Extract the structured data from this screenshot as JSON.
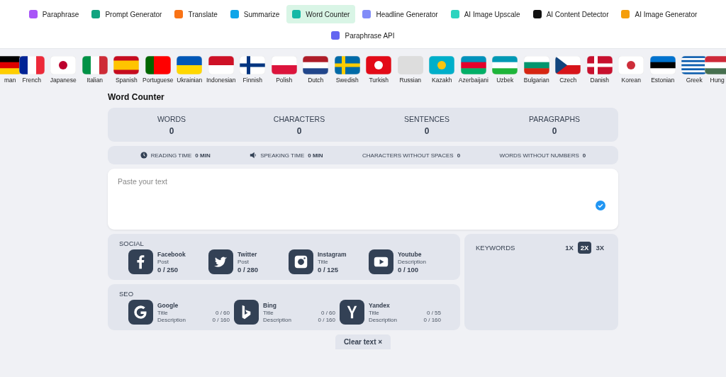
{
  "nav": [
    {
      "label": "Paraphrase",
      "color": "#a855f7",
      "selected": false
    },
    {
      "label": "Prompt Generator",
      "color": "#10a37f",
      "selected": false
    },
    {
      "label": "Translate",
      "color": "#f97316",
      "selected": false
    },
    {
      "label": "Summarize",
      "color": "#0ea5e9",
      "selected": false
    },
    {
      "label": "Word Counter",
      "color": "#14b8a6",
      "selected": true
    },
    {
      "label": "Headline Generator",
      "color": "#818cf8",
      "selected": false
    },
    {
      "label": "AI Image Upscale",
      "color": "#2dd4bf",
      "selected": false
    },
    {
      "label": "AI Content Detector",
      "color": "#111111",
      "selected": false
    },
    {
      "label": "AI Image Generator",
      "color": "#f59e0b",
      "selected": false
    },
    {
      "label": "Paraphrase API",
      "color": "#6366f1",
      "selected": false
    }
  ],
  "languages": [
    {
      "label": "man",
      "kind": "de"
    },
    {
      "label": "French",
      "kind": "fr"
    },
    {
      "label": "Japanese",
      "kind": "jp"
    },
    {
      "label": "Italian",
      "kind": "it"
    },
    {
      "label": "Spanish",
      "kind": "es"
    },
    {
      "label": "Portuguese",
      "kind": "pt"
    },
    {
      "label": "Ukrainian",
      "kind": "ua"
    },
    {
      "label": "Indonesian",
      "kind": "id"
    },
    {
      "label": "Finnish",
      "kind": "fi"
    },
    {
      "label": "Polish",
      "kind": "pl"
    },
    {
      "label": "Dutch",
      "kind": "nl"
    },
    {
      "label": "Swedish",
      "kind": "se"
    },
    {
      "label": "Turkish",
      "kind": "tr"
    },
    {
      "label": "Russian",
      "kind": "blank"
    },
    {
      "label": "Kazakh",
      "kind": "kz"
    },
    {
      "label": "Azerbaijani",
      "kind": "az"
    },
    {
      "label": "Uzbek",
      "kind": "uz"
    },
    {
      "label": "Bulgarian",
      "kind": "bg"
    },
    {
      "label": "Czech",
      "kind": "cz"
    },
    {
      "label": "Danish",
      "kind": "dk"
    },
    {
      "label": "Korean",
      "kind": "kr"
    },
    {
      "label": "Estonian",
      "kind": "ee"
    },
    {
      "label": "Greek",
      "kind": "gr"
    },
    {
      "label": "Hung",
      "kind": "hu"
    }
  ],
  "title": "Word Counter",
  "stats": [
    {
      "label": "WORDS",
      "value": "0"
    },
    {
      "label": "CHARACTERS",
      "value": "0"
    },
    {
      "label": "SENTENCES",
      "value": "0"
    },
    {
      "label": "PARAGRAPHS",
      "value": "0"
    }
  ],
  "info": [
    {
      "kind": "clock",
      "label": "READING TIME",
      "value": "0 MIN"
    },
    {
      "kind": "speaker",
      "label": "SPEAKING TIME",
      "value": "0 MIN"
    },
    {
      "kind": "none",
      "label": "CHARACTERS WITHOUT SPACES",
      "value": "0"
    },
    {
      "kind": "none",
      "label": "WORDS WITHOUT NUMBERS",
      "value": "0"
    }
  ],
  "editor": {
    "placeholder": "Paste your text"
  },
  "social": {
    "title": "SOCIAL",
    "items": [
      {
        "kind": "facebook",
        "name": "Facebook",
        "type": "Post",
        "count": "0 / 250"
      },
      {
        "kind": "twitter",
        "name": "Twitter",
        "type": "Post",
        "count": "0 / 280"
      },
      {
        "kind": "instagram",
        "name": "Instagram",
        "type": "Title",
        "count": "0 / 125"
      },
      {
        "kind": "youtube",
        "name": "Youtube",
        "type": "Description",
        "count": "0 / 100"
      }
    ]
  },
  "seo": {
    "title": "SEO",
    "items": [
      {
        "kind": "google",
        "name": "Google",
        "rows": [
          {
            "label": "Title",
            "value": "0 / 60"
          },
          {
            "label": "Description",
            "value": "0 / 160"
          }
        ]
      },
      {
        "kind": "bing",
        "name": "Bing",
        "rows": [
          {
            "label": "Title",
            "value": "0 / 60"
          },
          {
            "label": "Description",
            "value": "0 / 160"
          }
        ]
      },
      {
        "kind": "yandex",
        "name": "Yandex",
        "rows": [
          {
            "label": "Title",
            "value": "0 / 55"
          },
          {
            "label": "Description",
            "value": "0 / 160"
          }
        ]
      }
    ]
  },
  "keywords": {
    "title": "KEYWORDS",
    "options": [
      {
        "label": "1X",
        "selected": false
      },
      {
        "label": "2X",
        "selected": true
      },
      {
        "label": "3X",
        "selected": false
      }
    ]
  },
  "clear_button": {
    "label": "Clear text",
    "icon": "×"
  }
}
